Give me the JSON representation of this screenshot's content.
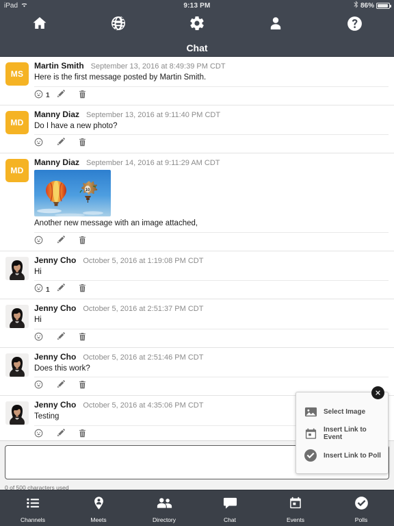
{
  "status_bar": {
    "device": "iPad",
    "wifi_icon": "wifi-icon",
    "time": "9:13 PM",
    "bluetooth_icon": "bluetooth-icon",
    "battery_percent": "86%",
    "battery_icon": "battery-icon"
  },
  "top_nav": {
    "items": [
      {
        "name": "home-icon",
        "label": "Home"
      },
      {
        "name": "globe-icon",
        "label": "Globe"
      },
      {
        "name": "gear-icon",
        "label": "Settings"
      },
      {
        "name": "person-icon",
        "label": "Profile"
      },
      {
        "name": "help-icon",
        "label": "Help"
      }
    ]
  },
  "header": {
    "title": "Chat"
  },
  "colors": {
    "header_bg": "#414751",
    "tabbar_bg": "#3b4048",
    "avatar_amber": "#f5b324",
    "accent_text": "#8b8b8b"
  },
  "messages": [
    {
      "author": "Martin Smith",
      "timestamp": "September 13, 2016 at 8:49:39 PM CDT",
      "text": "Here is the first message posted by Martin Smith.",
      "avatar_type": "initials",
      "initials": "MS",
      "reaction_count": "1",
      "has_image": false
    },
    {
      "author": "Manny Diaz",
      "timestamp": "September 13, 2016 at 9:11:40 PM CDT",
      "text": "Do I have a new photo?",
      "avatar_type": "initials",
      "initials": "MD",
      "reaction_count": "",
      "has_image": false
    },
    {
      "author": "Manny Diaz",
      "timestamp": "September 14, 2016 at 9:11:29 AM CDT",
      "text": "Another new message with an image attached,",
      "avatar_type": "initials",
      "initials": "MD",
      "reaction_count": "",
      "has_image": true,
      "image_alt": "hot-air-balloons-photo"
    },
    {
      "author": "Jenny Cho",
      "timestamp": "October 5, 2016 at 1:19:08 PM CDT",
      "text": "Hi",
      "avatar_type": "photo",
      "initials": "",
      "reaction_count": "1",
      "has_image": false
    },
    {
      "author": "Jenny Cho",
      "timestamp": "October 5, 2016 at 2:51:37 PM CDT",
      "text": "Hi",
      "avatar_type": "photo",
      "initials": "",
      "reaction_count": "",
      "has_image": false
    },
    {
      "author": "Jenny Cho",
      "timestamp": "October 5, 2016 at 2:51:46 PM CDT",
      "text": "Does this work?",
      "avatar_type": "photo",
      "initials": "",
      "reaction_count": "",
      "has_image": false
    },
    {
      "author": "Jenny Cho",
      "timestamp": "October 5, 2016 at 4:35:06 PM CDT",
      "text": "Testing",
      "avatar_type": "photo",
      "initials": "",
      "reaction_count": "",
      "has_image": false
    }
  ],
  "message_actions": {
    "react_icon": "smiley-icon",
    "edit_icon": "pencil-icon",
    "delete_icon": "trash-icon"
  },
  "composer": {
    "value": "",
    "placeholder": "",
    "char_count": "0 of 500 characters used"
  },
  "attachment_popup": {
    "close_icon": "close-icon",
    "items": [
      {
        "icon": "image-icon",
        "label": "Select Image"
      },
      {
        "icon": "calendar-icon",
        "label": "Insert Link to Event"
      },
      {
        "icon": "check-circle-icon",
        "label": "Insert Link to Poll"
      }
    ]
  },
  "tab_bar": {
    "tabs": [
      {
        "icon": "list-icon",
        "label": "Channels"
      },
      {
        "icon": "map-pin-person-icon",
        "label": "Meets"
      },
      {
        "icon": "people-icon",
        "label": "Directory"
      },
      {
        "icon": "chat-bubble-icon",
        "label": "Chat"
      },
      {
        "icon": "calendar-icon",
        "label": "Events"
      },
      {
        "icon": "check-circle-icon",
        "label": "Polls"
      }
    ]
  }
}
